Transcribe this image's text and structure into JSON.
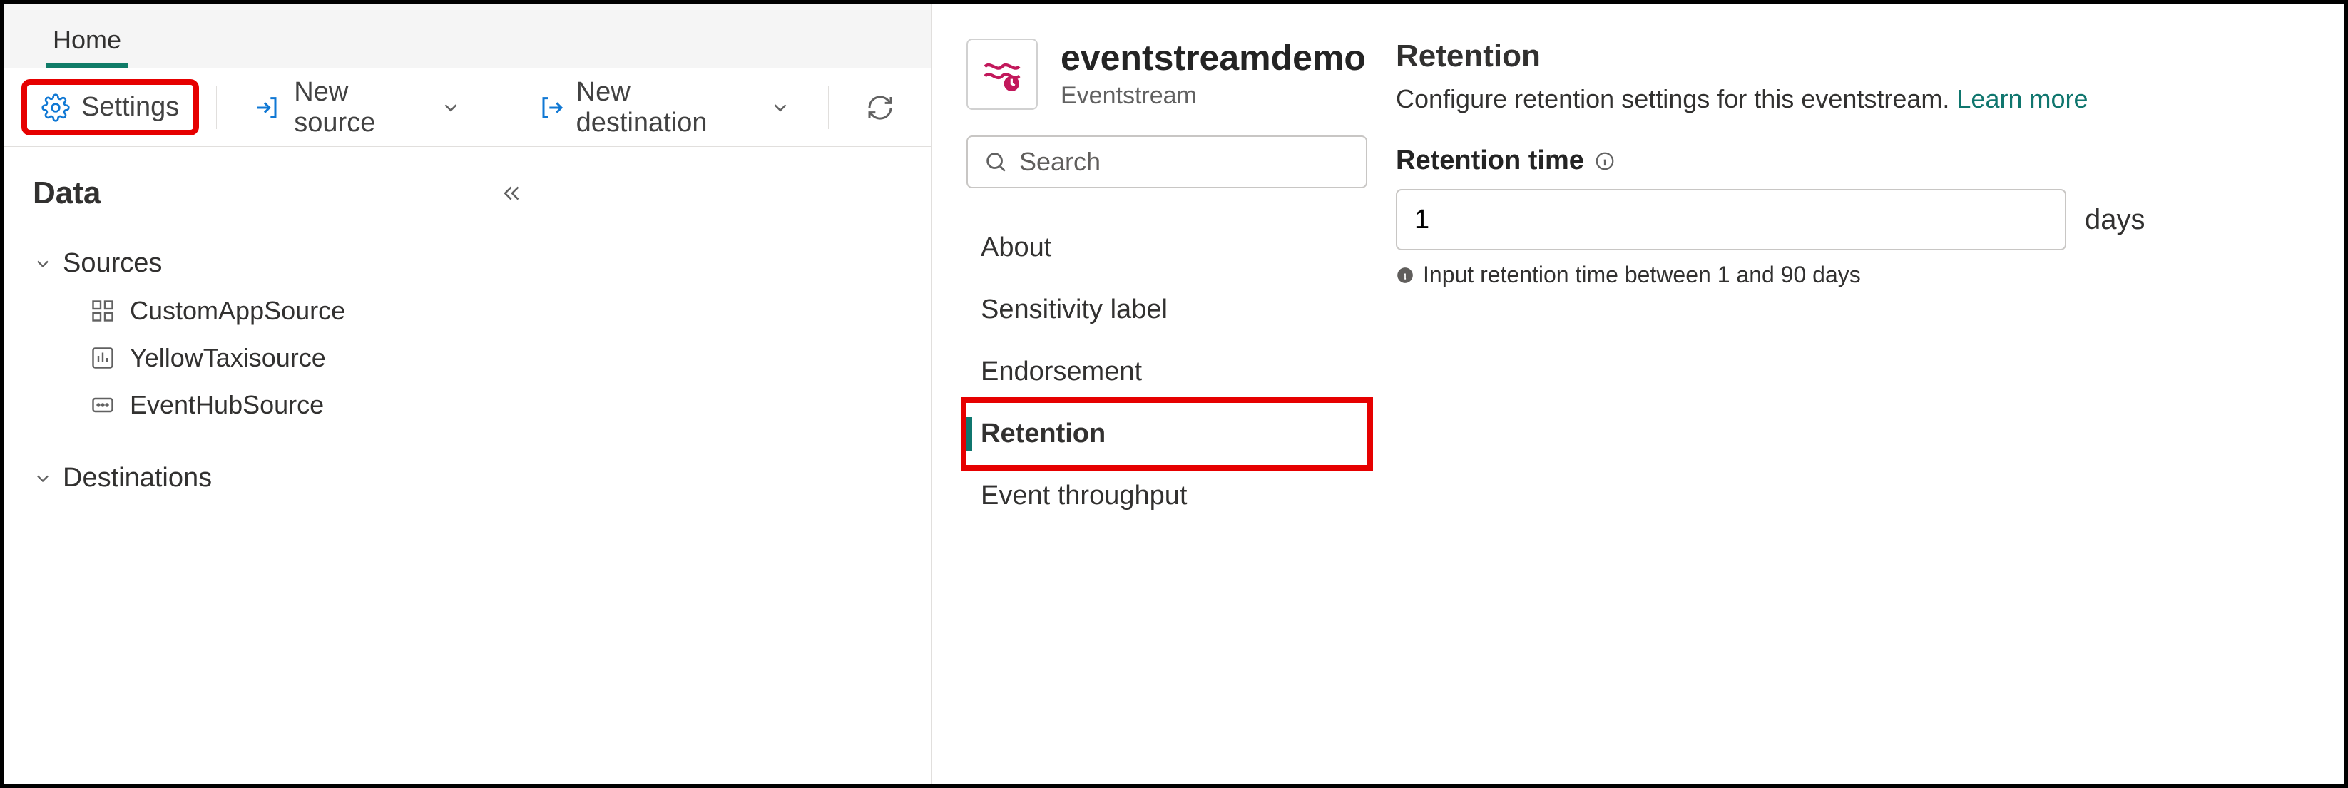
{
  "tabs": {
    "home": "Home"
  },
  "toolbar": {
    "settings": "Settings",
    "new_source": "New source",
    "new_destination": "New destination"
  },
  "sidebar": {
    "title": "Data",
    "sections": {
      "sources": {
        "label": "Sources",
        "items": [
          {
            "label": "CustomAppSource"
          },
          {
            "label": "YellowTaxisource"
          },
          {
            "label": "EventHubSource"
          }
        ]
      },
      "destinations": {
        "label": "Destinations"
      }
    }
  },
  "panel": {
    "entity_title": "eventstreamdemo",
    "entity_subtitle": "Eventstream",
    "search_placeholder": "Search",
    "nav": {
      "about": "About",
      "sensitivity": "Sensitivity label",
      "endorsement": "Endorsement",
      "retention": "Retention",
      "throughput": "Event throughput"
    }
  },
  "retention": {
    "title": "Retention",
    "desc": "Configure retention settings for this eventstream.",
    "learn_more": "Learn more",
    "field_label": "Retention time",
    "value": "1",
    "unit": "days",
    "hint": "Input retention time between 1 and 90 days"
  }
}
